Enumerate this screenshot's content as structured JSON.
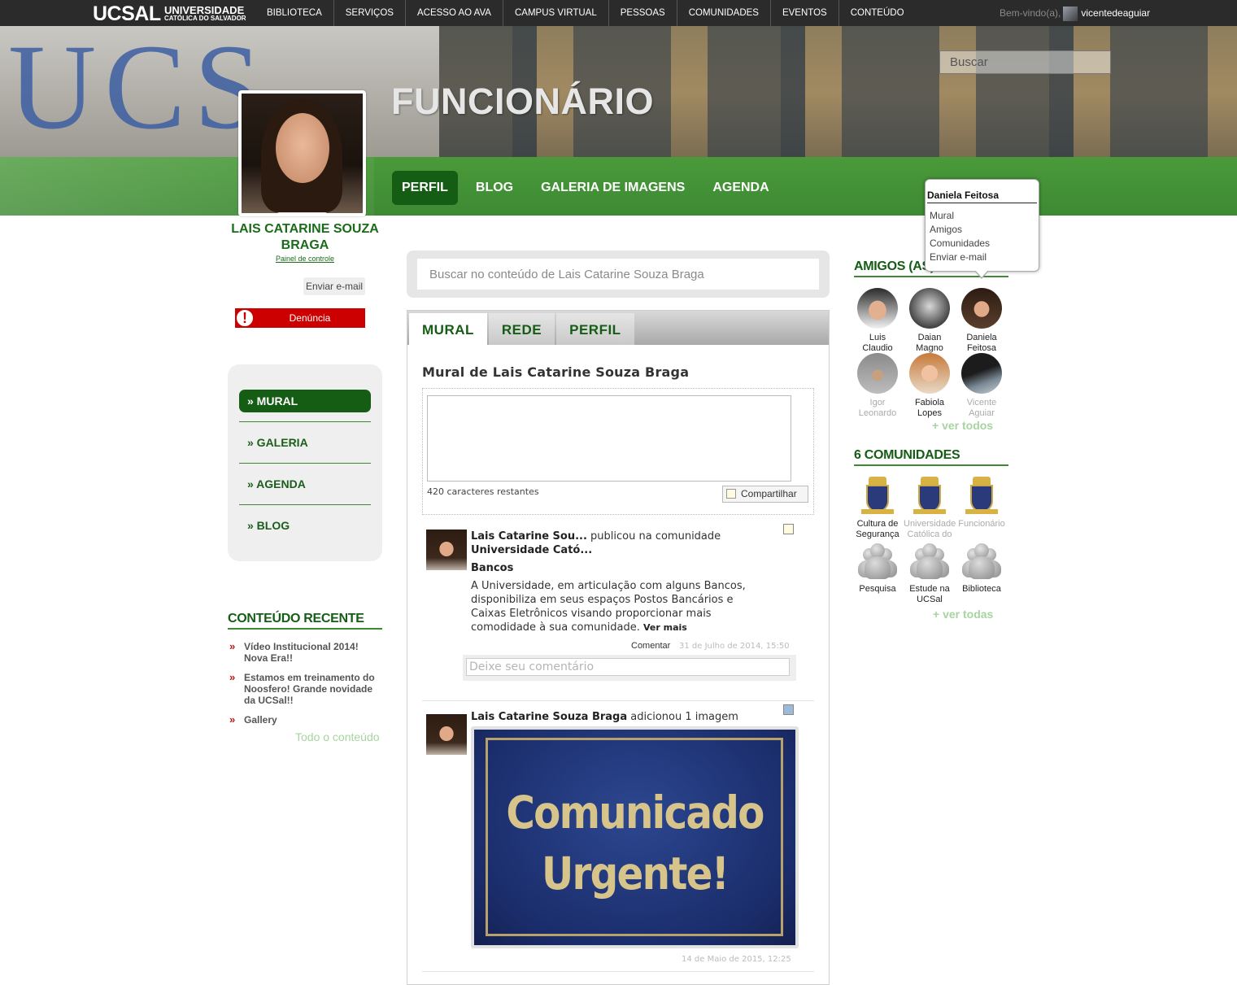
{
  "topbar": {
    "logo_main": "UCSAL",
    "logo_line1": "UNIVERSIDADE",
    "logo_line2": "CATÓLICA DO SALVADOR",
    "nav": [
      "BIBLIOTECA",
      "SERVIÇOS",
      "ACESSO AO AVA",
      "CAMPUS VIRTUAL",
      "PESSOAS",
      "COMUNIDADES",
      "EVENTOS",
      "CONTEÚDO"
    ],
    "welcome_label": "Bem-vindo(a),",
    "username": "vicentedeaguiar"
  },
  "header": {
    "banner_letters": "UCS",
    "title": "FUNCIONÁRIO",
    "search_placeholder": "Buscar",
    "tabs": [
      "PERFIL",
      "BLOG",
      "GALERIA DE IMAGENS",
      "AGENDA"
    ],
    "active_tab": "PERFIL"
  },
  "profile": {
    "name": "LAIS CATARINE SOUZA BRAGA",
    "control_panel": "Painel de controle",
    "send_email": "Enviar e-mail",
    "report": "Denúncia",
    "report_icon_glyph": "!"
  },
  "sidemenu": {
    "items": [
      "» MURAL",
      "» GALERIA",
      "» AGENDA",
      "» BLOG"
    ],
    "active": "» MURAL"
  },
  "recent": {
    "title": "CONTEÚDO RECENTE",
    "items": [
      "Vídeo Institucional 2014! Nova Era!!",
      "Estamos em treinamento do Noosfero! Grande novidade da UCSal!!",
      "Gallery"
    ],
    "bullet": "»",
    "all_link": "Todo o conteúdo"
  },
  "center": {
    "search_placeholder": "Buscar no conteúdo de Lais Catarine Souza Braga",
    "tabs": [
      "MURAL",
      "REDE",
      "PERFIL"
    ],
    "active_tab": "MURAL",
    "wall_title": "Mural de Lais Catarine Souza Braga",
    "chars_left": "420 caracteres restantes",
    "share_button": "Compartilhar",
    "post1": {
      "author": "Lais Catarine Sou...",
      "action": "publicou na comunidade",
      "community": "Universidade Cató...",
      "title": "Bancos",
      "body": "A Universidade, em articulação com alguns Bancos, disponibiliza em seus espaços Postos Bancários e Caixas Eletrônicos visando proporcionar mais comodidade à sua comunidade.",
      "read_more": "Ver mais",
      "comment_link": "Comentar",
      "date": "31 de Julho de 2014, 15:50",
      "comment_placeholder": "Deixe seu comentário"
    },
    "post2": {
      "author": "Lais Catarine Souza Braga",
      "action": "adicionou 1 imagem",
      "image_line1": "Comunicado",
      "image_line2": "Urgente!",
      "date": "14 de Maio de 2015, 12:25"
    }
  },
  "friends": {
    "title": "AMIGOS (AS)",
    "items": [
      {
        "name": "Luis Claudio"
      },
      {
        "name": "Daian Magno"
      },
      {
        "name": "Daniela Feitosa"
      },
      {
        "name": "Igor Leonardo"
      },
      {
        "name": "Fabiola Lopes"
      },
      {
        "name": "Vicente Aguiar"
      }
    ],
    "see_all": "+ ver todos"
  },
  "popup": {
    "title": "Daniela Feitosa",
    "items": [
      "Mural",
      "Amigos",
      "Comunidades",
      "Enviar e-mail"
    ]
  },
  "communities": {
    "title": "6 COMUNIDADES",
    "items": [
      {
        "name": "Cultura de Segurança"
      },
      {
        "name": "Universidade Católica do"
      },
      {
        "name": "Funcionário"
      },
      {
        "name": "Pesquisa"
      },
      {
        "name": "Estude na UCSal"
      },
      {
        "name": "Biblioteca"
      }
    ],
    "see_all": "+ ver todas"
  },
  "colors": {
    "brand_green": "#155d15",
    "banner_green": "#3d8a33",
    "report_red": "#cc0000"
  }
}
